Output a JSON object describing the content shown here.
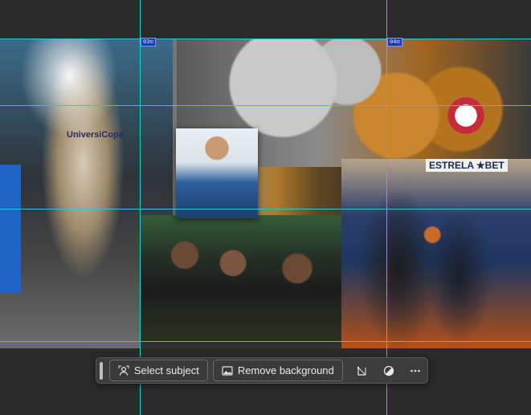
{
  "canvas": {
    "slice_labels": [
      "03",
      "04"
    ],
    "image_text": {
      "trophy_brand": "UniversiCopa",
      "sponsor_banner": "ESTRELA ★BET"
    }
  },
  "contextual_task_bar": {
    "select_subject_label": "Select subject",
    "remove_background_label": "Remove background",
    "icons": [
      "select-subject-icon",
      "image-icon",
      "crop-transform-icon",
      "adjustment-icon",
      "more-options-icon"
    ]
  },
  "colors": {
    "guide": "#1ecbe1",
    "slice_label_bg": "#1a3aa8",
    "workspace_bg": "#2a2a2a",
    "taskbar_bg": "#3c3c3c"
  }
}
